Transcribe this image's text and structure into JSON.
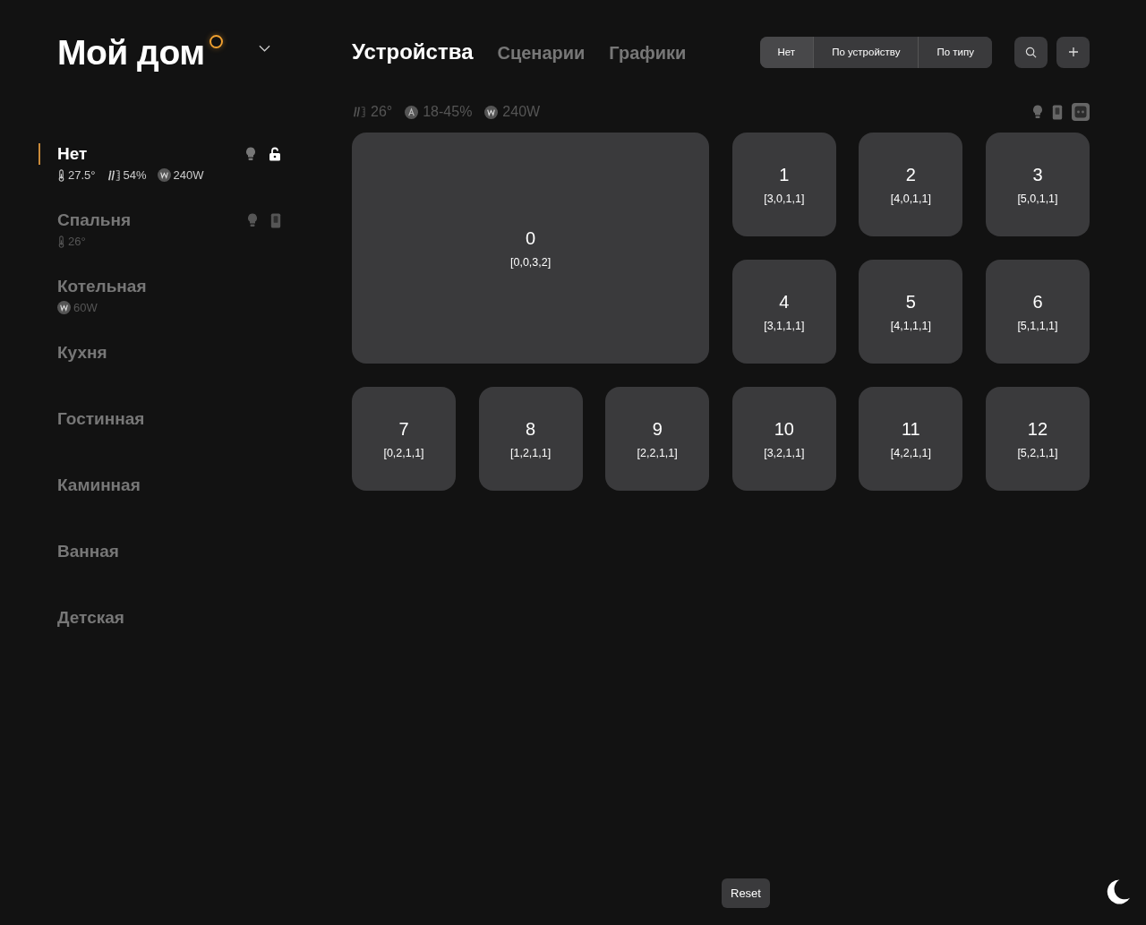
{
  "home": {
    "title": "Мой дом"
  },
  "tabs": [
    {
      "label": "Устройства",
      "selected": true
    },
    {
      "label": "Сценарии",
      "selected": false
    },
    {
      "label": "Графики",
      "selected": false
    }
  ],
  "grouping": [
    {
      "label": "Нет",
      "selected": true
    },
    {
      "label": "По устройству",
      "selected": false
    },
    {
      "label": "По типу",
      "selected": false
    }
  ],
  "summary": {
    "stats": [
      {
        "kind": "humidity",
        "value": "26°"
      },
      {
        "kind": "auto",
        "value": "18-45%"
      },
      {
        "kind": "power",
        "value": "240W"
      }
    ],
    "device_icons": [
      {
        "kind": "bulb"
      },
      {
        "kind": "switch"
      },
      {
        "kind": "socket"
      }
    ]
  },
  "rooms": [
    {
      "name": "Нет",
      "selected": true,
      "sensors": [
        {
          "kind": "temperature",
          "value": "27.5°"
        },
        {
          "kind": "humidity",
          "value": "54%"
        },
        {
          "kind": "power",
          "value": "240W"
        }
      ],
      "devices": [
        {
          "kind": "bulb"
        },
        {
          "kind": "lock"
        }
      ]
    },
    {
      "name": "Спальня",
      "selected": false,
      "sensors": [
        {
          "kind": "temperature",
          "value": "26°"
        }
      ],
      "devices": [
        {
          "kind": "bulb"
        },
        {
          "kind": "switch"
        }
      ]
    },
    {
      "name": "Котельная",
      "selected": false,
      "sensors": [
        {
          "kind": "power",
          "value": "60W"
        }
      ]
    },
    {
      "name": "Кухня",
      "selected": false
    },
    {
      "name": "Гостинная",
      "selected": false
    },
    {
      "name": "Каминная",
      "selected": false
    },
    {
      "name": "Ванная",
      "selected": false
    },
    {
      "name": "Детская",
      "selected": false
    }
  ],
  "tiles": [
    {
      "kind": "large",
      "label": "0",
      "coords": "[0,0,3,2]"
    },
    {
      "kind": "small",
      "label": "1",
      "coords": "[3,0,1,1]"
    },
    {
      "kind": "small",
      "label": "2",
      "coords": "[4,0,1,1]"
    },
    {
      "kind": "small",
      "label": "3",
      "coords": "[5,0,1,1]"
    },
    {
      "kind": "small",
      "label": "4",
      "coords": "[3,1,1,1]"
    },
    {
      "kind": "small",
      "label": "5",
      "coords": "[4,1,1,1]"
    },
    {
      "kind": "small",
      "label": "6",
      "coords": "[5,1,1,1]"
    },
    {
      "kind": "small",
      "label": "7",
      "coords": "[0,2,1,1]"
    },
    {
      "kind": "small",
      "label": "8",
      "coords": "[1,2,1,1]"
    },
    {
      "kind": "small",
      "label": "9",
      "coords": "[2,2,1,1]"
    },
    {
      "kind": "small",
      "label": "10",
      "coords": "[3,2,1,1]"
    },
    {
      "kind": "small",
      "label": "11",
      "coords": "[4,2,1,1]"
    },
    {
      "kind": "small",
      "label": "12",
      "coords": "[5,2,1,1]"
    }
  ],
  "reset_button": "Reset"
}
